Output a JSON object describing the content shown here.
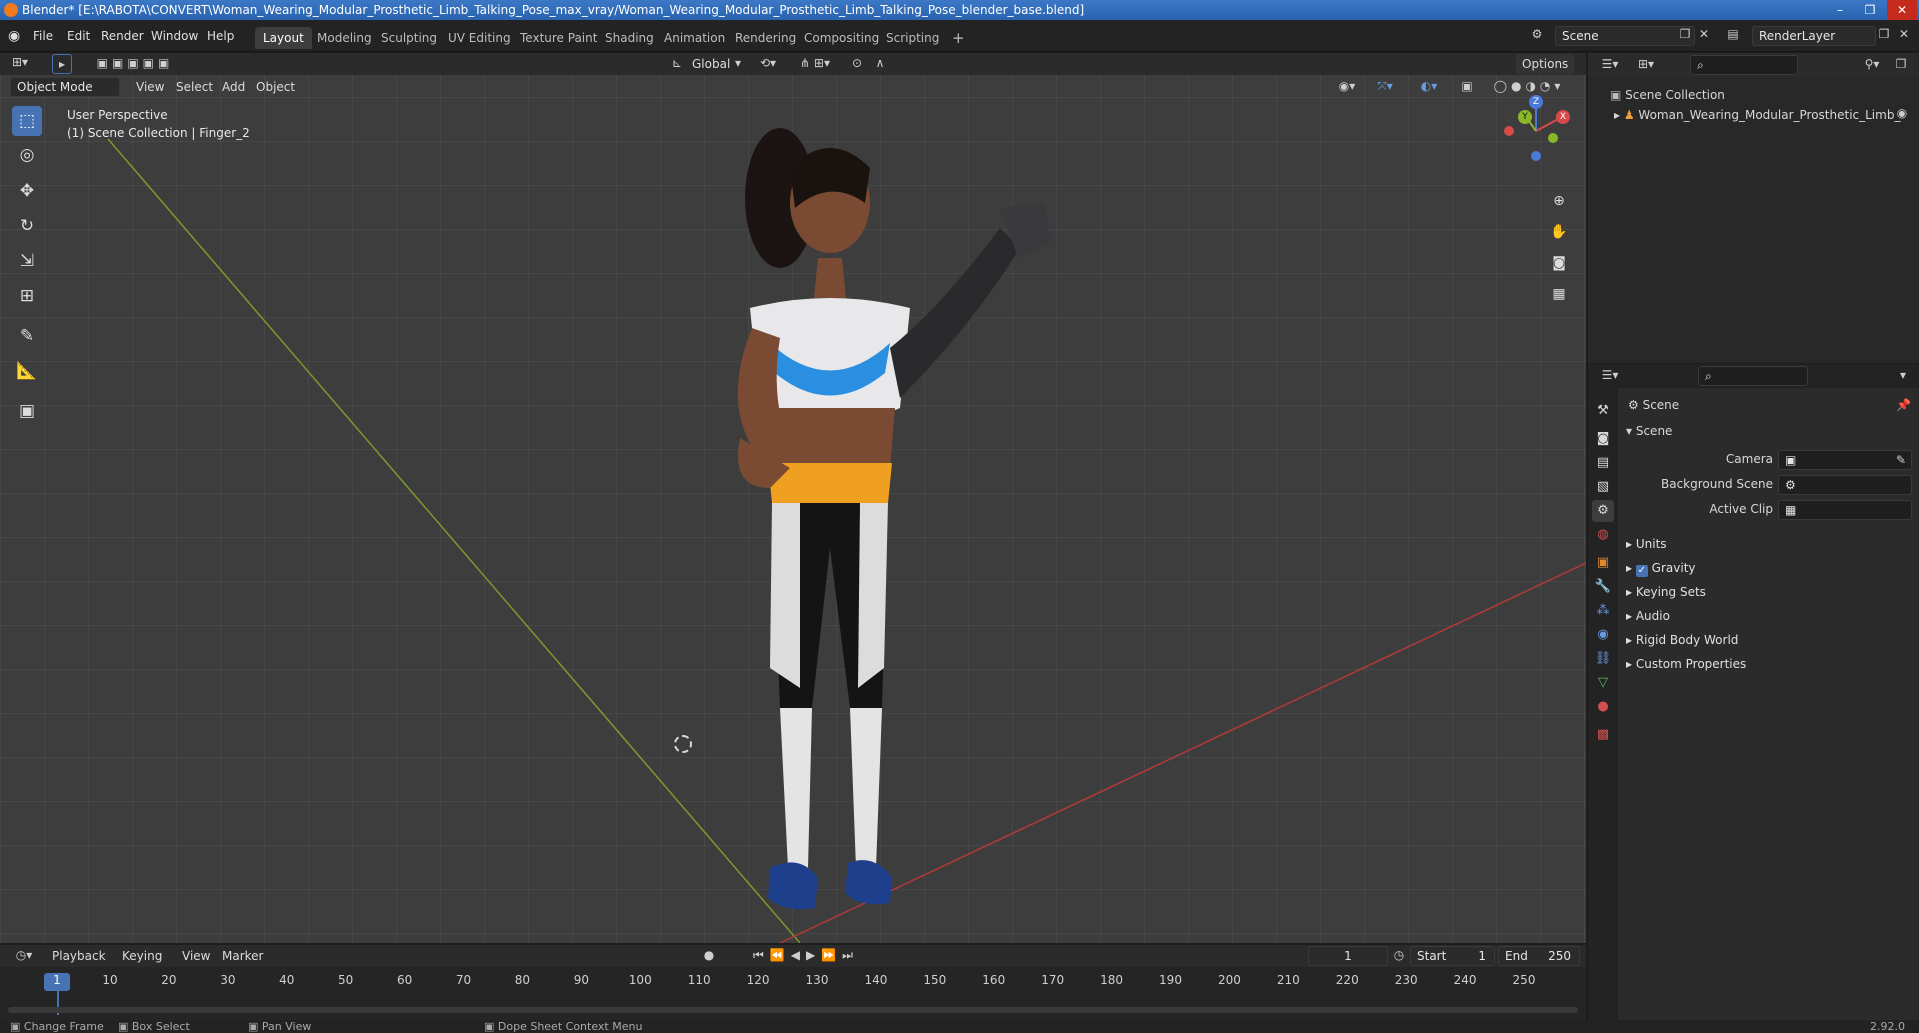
{
  "window": {
    "title": "Blender* [E:\\RABOTA\\CONVERT\\Woman_Wearing_Modular_Prosthetic_Limb_Talking_Pose_max_vray/Woman_Wearing_Modular_Prosthetic_Limb_Talking_Pose_blender_base.blend]",
    "minimize": "–",
    "maximize": "❐",
    "close": "✕"
  },
  "menus": [
    "File",
    "Edit",
    "Render",
    "Window",
    "Help"
  ],
  "workspaces": [
    "Layout",
    "Modeling",
    "Sculpting",
    "UV Editing",
    "Texture Paint",
    "Shading",
    "Animation",
    "Rendering",
    "Compositing",
    "Scripting"
  ],
  "workspace_add": "+",
  "scene_name": "Scene",
  "render_layer": "RenderLayer",
  "viewport": {
    "transform_orientation": "Global",
    "options_label": "Options",
    "mode": "Object Mode",
    "header_menus": [
      "View",
      "Select",
      "Add",
      "Object"
    ],
    "perspective_label": "User Perspective",
    "collection_info": "(1) Scene Collection | Finger_2",
    "gizmo": {
      "z": "Z",
      "x": "X",
      "y": "Y"
    }
  },
  "outliner": {
    "root": "Scene Collection",
    "items": [
      "Woman_Wearing_Modular_Prosthetic_Limb_"
    ]
  },
  "properties": {
    "context_title": "Scene",
    "section_title": "Scene",
    "fields": [
      {
        "label": "Camera",
        "value": ""
      },
      {
        "label": "Background Scene",
        "value": ""
      },
      {
        "label": "Active Clip",
        "value": ""
      }
    ],
    "panels": [
      {
        "label": "Units",
        "checkbox": false
      },
      {
        "label": "Gravity",
        "checkbox": true
      },
      {
        "label": "Keying Sets",
        "checkbox": false
      },
      {
        "label": "Audio",
        "checkbox": false
      },
      {
        "label": "Rigid Body World",
        "checkbox": false
      },
      {
        "label": "Custom Properties",
        "checkbox": false
      }
    ]
  },
  "timeline": {
    "menus": [
      "Playback",
      "Keying",
      "View",
      "Marker"
    ],
    "current_frame": "1",
    "start_label": "Start",
    "start_value": "1",
    "end_label": "End",
    "end_value": "250",
    "ticks": [
      "1",
      "10",
      "20",
      "30",
      "40",
      "50",
      "60",
      "70",
      "80",
      "90",
      "100",
      "110",
      "120",
      "130",
      "140",
      "150",
      "160",
      "170",
      "180",
      "190",
      "200",
      "210",
      "220",
      "230",
      "240",
      "250"
    ]
  },
  "status_bar": {
    "items": [
      "Change Frame",
      "Box Select",
      "Pan View",
      "Dope Sheet Context Menu"
    ],
    "version": "2.92.0"
  }
}
